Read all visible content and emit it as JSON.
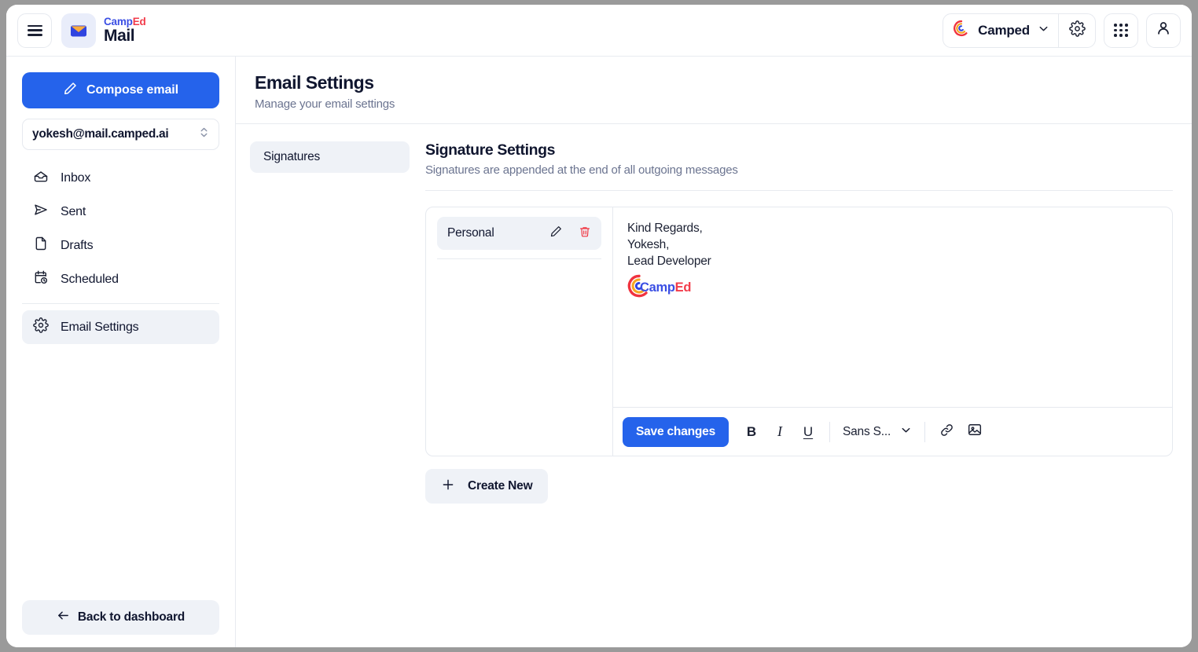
{
  "topbar": {
    "menu_icon": "hamburger-icon",
    "brand": {
      "top_camp": "Camp",
      "top_ed": "Ed",
      "bottom": "Mail",
      "mark_icon": "envelope-icon"
    },
    "org": {
      "name": "Camped",
      "logo_icon": "camped-circle-logo",
      "chevron_icon": "chevron-down-icon"
    },
    "settings_icon": "gear-icon",
    "apps_icon": "apps-grid-icon",
    "profile_icon": "user-icon"
  },
  "sidebar": {
    "compose_label": "Compose email",
    "compose_icon": "pencil-icon",
    "account_email": "yokesh@mail.camped.ai",
    "account_chevron_icon": "chevron-up-down-icon",
    "items": [
      {
        "label": "Inbox",
        "icon": "inbox-icon",
        "active": false
      },
      {
        "label": "Sent",
        "icon": "send-icon",
        "active": false
      },
      {
        "label": "Drafts",
        "icon": "file-icon",
        "active": false
      },
      {
        "label": "Scheduled",
        "icon": "calendar-clock-icon",
        "active": false
      },
      {
        "label": "Email Settings",
        "icon": "gear-icon",
        "active": true
      }
    ],
    "back_label": "Back to dashboard",
    "back_icon": "arrow-left-icon"
  },
  "main": {
    "title": "Email Settings",
    "subtitle": "Manage your email settings",
    "tabs": [
      {
        "label": "Signatures",
        "active": true
      }
    ],
    "section": {
      "title": "Signature Settings",
      "subtitle": "Signatures are appended at the end of all outgoing messages"
    },
    "signatures": [
      {
        "name": "Personal",
        "edit_icon": "pencil-icon",
        "delete_icon": "trash-icon"
      }
    ],
    "signature_content": {
      "lines": [
        "Kind Regards,",
        "Yokesh,",
        "Lead Developer"
      ],
      "logo": {
        "icon": "camped-circle-logo",
        "word_camp": "Camp",
        "word_ed": "Ed"
      }
    },
    "editor_toolbar": {
      "save_label": "Save changes",
      "bold_label": "B",
      "italic_label": "I",
      "underline_label": "U",
      "font_value": "Sans S...",
      "font_chevron_icon": "chevron-down-icon",
      "link_icon": "link-icon",
      "image_icon": "image-icon"
    },
    "create_new_label": "Create New",
    "create_new_icon": "plus-icon"
  },
  "colors": {
    "accent_blue": "#2563eb",
    "brand_indigo": "#3b4fe4",
    "brand_red": "#f23b4a",
    "panel_gray": "#eff2f7",
    "text_dark": "#10162f",
    "text_muted": "#6b7490"
  }
}
